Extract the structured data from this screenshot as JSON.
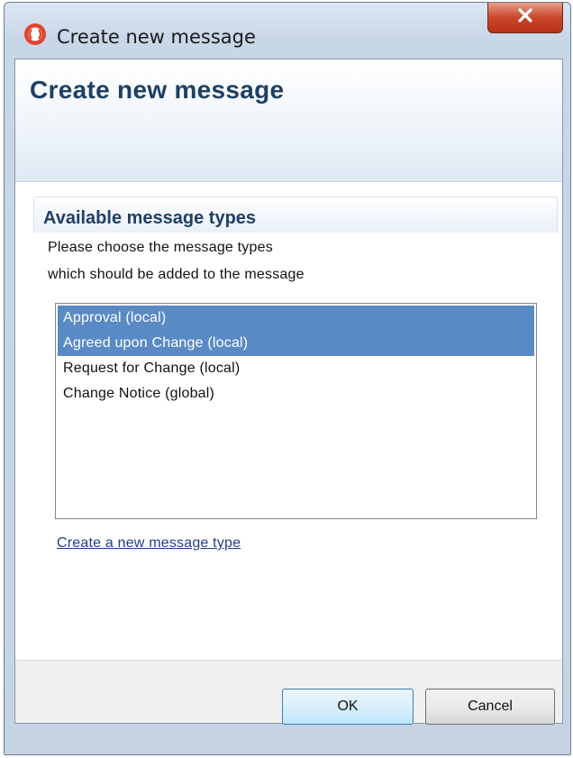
{
  "window": {
    "title": "Create new message",
    "close_glyph": "X"
  },
  "header": {
    "title": "Create new message"
  },
  "section": {
    "title": "Available message types",
    "instruction_line1": "Please choose the message types",
    "instruction_line2": "which should be added to the message"
  },
  "message_types": [
    {
      "label": "Approval (local)",
      "selected": true
    },
    {
      "label": "Agreed upon Change (local)",
      "selected": true
    },
    {
      "label": "Request for Change (local)",
      "selected": false
    },
    {
      "label": "Change Notice (global)",
      "selected": false
    }
  ],
  "create_link": "Create a new message type",
  "buttons": {
    "ok": "OK",
    "cancel": "Cancel"
  },
  "colors": {
    "selection": "#5a8ac6",
    "heading": "#1e3f66",
    "link": "#1f3d8a",
    "app_icon": "#e2452d"
  },
  "icons": {
    "app": "app-logo-icon",
    "close": "close-icon"
  }
}
